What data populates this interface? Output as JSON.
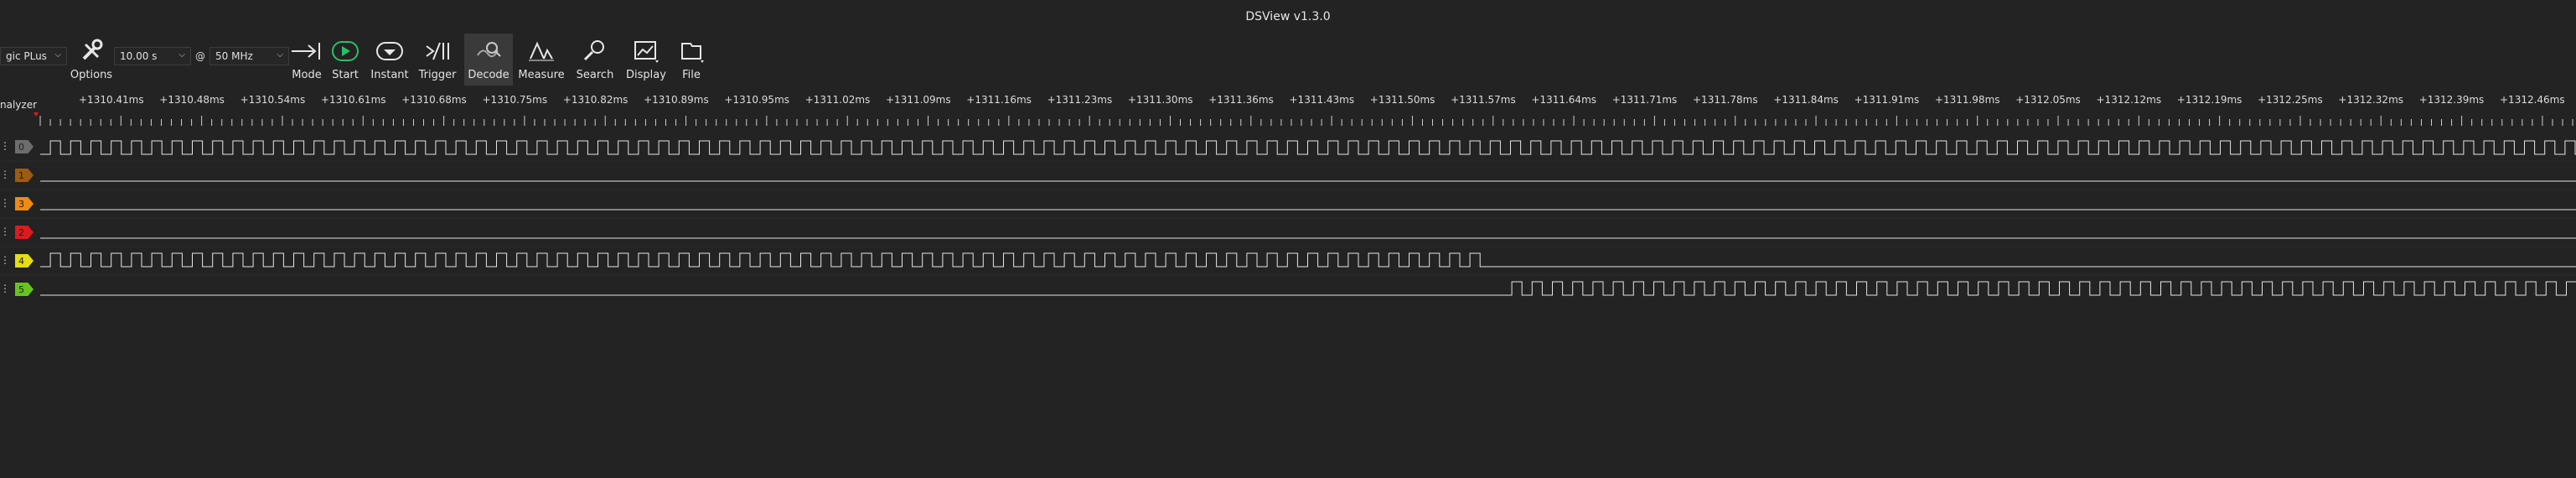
{
  "window": {
    "title": "DSView v1.3.0"
  },
  "toolbar": {
    "device": "gic PLus",
    "duration": "10.00 s",
    "at": "@",
    "samplerate": "50 MHz",
    "tools": [
      {
        "label": "Options",
        "icon": "options-icon"
      },
      {
        "label": "Mode",
        "icon": "mode-icon"
      },
      {
        "label": "Start",
        "icon": "start-icon"
      },
      {
        "label": "Instant",
        "icon": "instant-icon"
      },
      {
        "label": "Trigger",
        "icon": "trigger-icon"
      },
      {
        "label": "Decode",
        "icon": "decode-icon"
      },
      {
        "label": "Measure",
        "icon": "measure-icon"
      },
      {
        "label": "Search",
        "icon": "search-icon"
      },
      {
        "label": "Display",
        "icon": "display-icon"
      },
      {
        "label": "File",
        "icon": "file-icon"
      }
    ]
  },
  "ruler": {
    "left_label": "nalyzer",
    "labels": [
      "+1310.41ms",
      "+1310.48ms",
      "+1310.54ms",
      "+1310.61ms",
      "+1310.68ms",
      "+1310.75ms",
      "+1310.82ms",
      "+1310.89ms",
      "+1310.95ms",
      "+1311.02ms",
      "+1311.09ms",
      "+1311.16ms",
      "+1311.23ms",
      "+1311.30ms",
      "+1311.36ms",
      "+1311.43ms",
      "+1311.50ms",
      "+1311.57ms",
      "+1311.64ms",
      "+1311.71ms",
      "+1311.78ms",
      "+1311.84ms",
      "+1311.91ms",
      "+1311.98ms",
      "+1312.05ms",
      "+1312.12ms",
      "+1312.19ms",
      "+1312.25ms",
      "+1312.32ms",
      "+1312.39ms",
      "+1312.46ms"
    ]
  },
  "channels": [
    {
      "label": "0",
      "color": "#6d6d6d",
      "class": "grey"
    },
    {
      "label": "1",
      "color": "#9c5b12",
      "class": "brown"
    },
    {
      "label": "3",
      "color": "#ef8a12",
      "class": "orange"
    },
    {
      "label": "2",
      "color": "#d71d1d",
      "class": "red"
    },
    {
      "label": "4",
      "color": "#e6dd13",
      "class": "yellow"
    },
    {
      "label": "5",
      "color": "#67c41d",
      "class": "green"
    }
  ],
  "colors": {
    "background": "#232323",
    "trace": "#e6e6e6",
    "start": "#27c267"
  }
}
